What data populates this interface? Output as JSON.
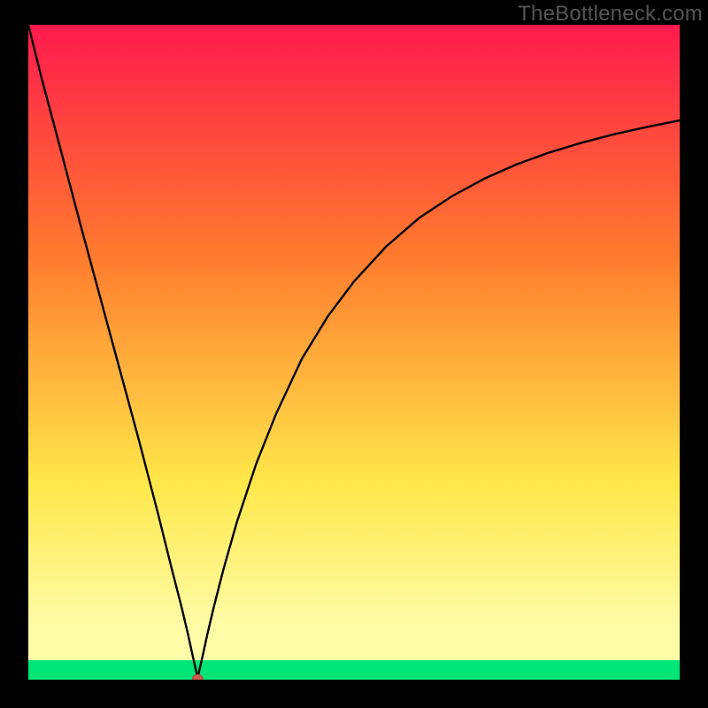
{
  "watermark": {
    "text": "TheBottleneck.com"
  },
  "colors": {
    "page_bg": "#000000",
    "curve": "#000000",
    "dot_fill": "#cc5a4e",
    "dot_stroke": "#a8483d",
    "grad_top": "#ff1a4d",
    "grad_midtop": "#ff7a2e",
    "grad_midbot": "#ffe84a",
    "grad_above_green": "#fffca8",
    "grad_green": "#00e676"
  },
  "chart_data": {
    "type": "line",
    "title": "",
    "xlabel": "",
    "ylabel": "",
    "xlim": [
      0,
      100
    ],
    "ylim": [
      0,
      100
    ],
    "min_point": {
      "x": 26,
      "y": 0
    },
    "series": [
      {
        "name": "curve",
        "x": [
          0,
          2,
          5,
          8,
          11,
          14,
          17,
          20,
          22,
          23.5,
          24.5,
          25.2,
          25.7,
          26,
          26.3,
          26.8,
          27.5,
          28.5,
          30,
          32,
          35,
          38,
          42,
          46,
          50,
          55,
          60,
          65,
          70,
          75,
          80,
          85,
          90,
          95,
          100
        ],
        "y": [
          100,
          92,
          80.8,
          69.5,
          58.5,
          47.5,
          36.5,
          25,
          17,
          11.2,
          7,
          3.8,
          1.6,
          0.3,
          1.6,
          3.8,
          7,
          11.2,
          17,
          24,
          33,
          40.5,
          49,
          55.5,
          60.8,
          66.2,
          70.5,
          73.8,
          76.5,
          78.7,
          80.5,
          82,
          83.3,
          84.4,
          85.4
        ]
      }
    ]
  }
}
